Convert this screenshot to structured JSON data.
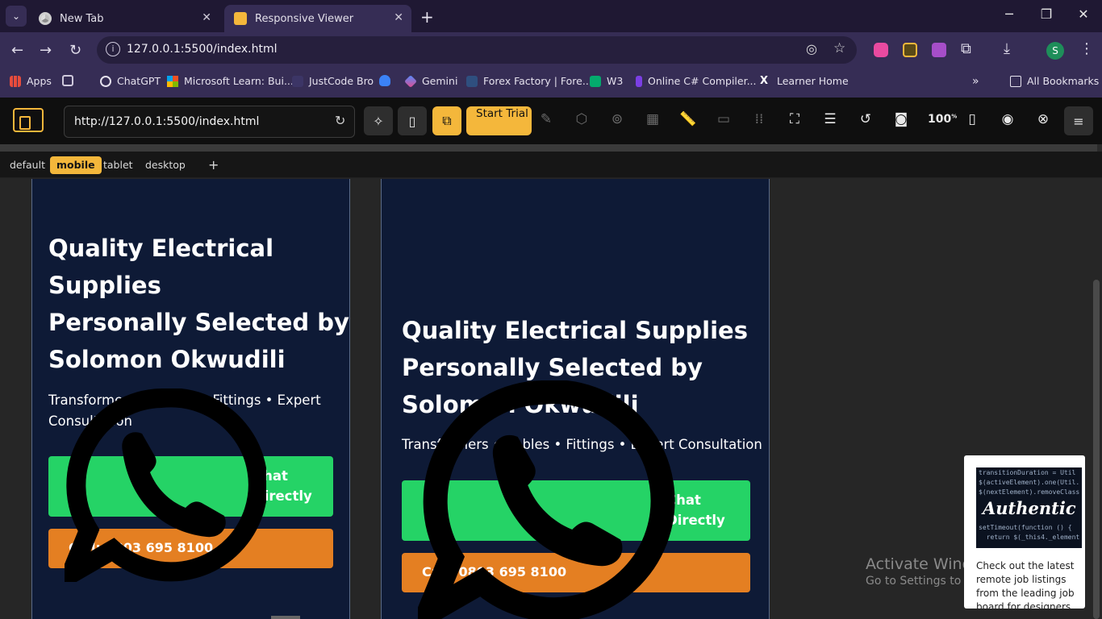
{
  "browser": {
    "tabs": [
      {
        "label": "New Tab",
        "active": false
      },
      {
        "label": "Responsive Viewer",
        "active": true
      }
    ],
    "url": "127.0.0.1:5500/index.html",
    "bookmarks": [
      {
        "label": "Apps"
      },
      {
        "label": "ChatGPT"
      },
      {
        "label": "Microsoft Learn: Bui..."
      },
      {
        "label": "JustCode Bro"
      },
      {
        "label": "Gemini"
      },
      {
        "label": "Forex Factory | Fore..."
      },
      {
        "label": "W3"
      },
      {
        "label": "Online C# Compiler..."
      },
      {
        "label": "Learner Home"
      },
      {
        "label": "All Bookmarks"
      }
    ],
    "profile_initial": "S"
  },
  "viewer": {
    "url": "http://127.0.0.1:5500/index.html",
    "start_trial": "Start Trial",
    "zoom": "100",
    "zoom_unit": "%",
    "device_tabs": [
      {
        "label": "default",
        "active": false
      },
      {
        "label": "mobile",
        "active": true
      },
      {
        "label": "tablet",
        "active": false
      },
      {
        "label": "desktop",
        "active": false
      }
    ],
    "add_label": "+"
  },
  "site": {
    "title_lines_narrow": [
      "Quality Electrical",
      "Supplies",
      "Personally Selected by",
      "Solomon Okwudili"
    ],
    "title_lines_wide": [
      "Quality Electrical Supplies",
      "Personally Selected by",
      "Solomon Okwudili"
    ],
    "subtitle_narrow": [
      "Transformers • Cables • Fittings • Expert",
      "Consultation"
    ],
    "subtitle_wide": "Transformers • Cables • Fittings • Expert Consultation",
    "whatsapp_label_1": "Chat",
    "whatsapp_label_2": "Directly",
    "call_label": "Call: 0803 695 8100"
  },
  "overlay": {
    "activate_title": "Activate Windows",
    "activate_sub": "Go to Settings to activate Windows.",
    "ad_logo": "Authentic",
    "ad_text": "Check out the latest remote job listings from the leading job board for designers"
  },
  "colors": {
    "accent": "#f4b73b",
    "hero_bg": "#0e1a36",
    "whatsapp": "#25d366",
    "call": "#e47f22"
  }
}
